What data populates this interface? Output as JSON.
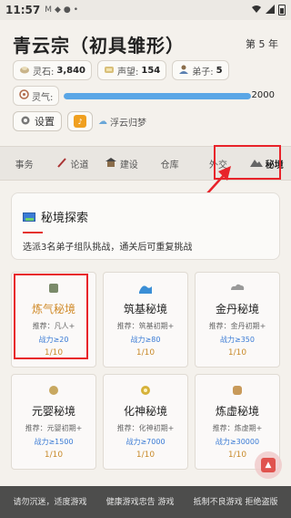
{
  "status": {
    "time": "11:57",
    "small_icons": [
      "M",
      "◆",
      "●"
    ],
    "dot": "•"
  },
  "header": {
    "title": "青云宗（初具雏形）",
    "year": "第 5 年"
  },
  "resources": [
    {
      "icon": "spirit-stone-icon",
      "label": "灵石:",
      "value": "3,840"
    },
    {
      "icon": "prestige-icon",
      "label": "声望:",
      "value": "154"
    },
    {
      "icon": "disciple-icon",
      "label": "弟子:",
      "value": "5"
    }
  ],
  "qi": {
    "label": "灵气:",
    "value": "2000",
    "fill_fraction": 1.0
  },
  "controls": {
    "settings_label": "设置",
    "cloud_label": "浮云归梦"
  },
  "tabs": [
    {
      "label": "事务",
      "icon": ""
    },
    {
      "label": "论道",
      "icon": "brush-icon"
    },
    {
      "label": "建设",
      "icon": "building-icon"
    },
    {
      "label": "仓库",
      "icon": ""
    },
    {
      "label": "外交",
      "icon": ""
    },
    {
      "label": "秘境",
      "icon": "mountain-icon",
      "active": true
    }
  ],
  "explore": {
    "title": "秘境探索",
    "desc": "选派3名弟子组队挑战，通关后可重复挑战"
  },
  "realms": [
    {
      "name": "炼气秘境",
      "rec": "推荐：凡人+",
      "power": "战力≥20",
      "count": "1/10",
      "icon": "🀄"
    },
    {
      "name": "筑基秘境",
      "rec": "推荐：筑基初期+",
      "power": "战力≥80",
      "count": "1/10",
      "icon": "🌊"
    },
    {
      "name": "金丹秘境",
      "rec": "推荐：金丹初期+",
      "power": "战力≥350",
      "count": "1/10",
      "icon": "☁"
    },
    {
      "name": "元婴秘境",
      "rec": "推荐：元婴初期+",
      "power": "战力≥1500",
      "count": "1/10",
      "icon": "❖"
    },
    {
      "name": "化神秘境",
      "rec": "推荐：化神初期+",
      "power": "战力≥7000",
      "count": "1/10",
      "icon": "✿"
    },
    {
      "name": "炼虚秘境",
      "rec": "推荐：炼虚期+",
      "power": "战力≥30000",
      "count": "1/10",
      "icon": "✦"
    }
  ],
  "bottom_notice": [
    "请勿沉迷，适度游戏",
    "健康游戏忠告\n游戏",
    "抵制不良游戏 拒绝盗版"
  ],
  "colors": {
    "accent": "#e8232a",
    "qi_bar": "#5aa6e6",
    "power": "#3a7bd5",
    "count": "#c88a2a"
  }
}
